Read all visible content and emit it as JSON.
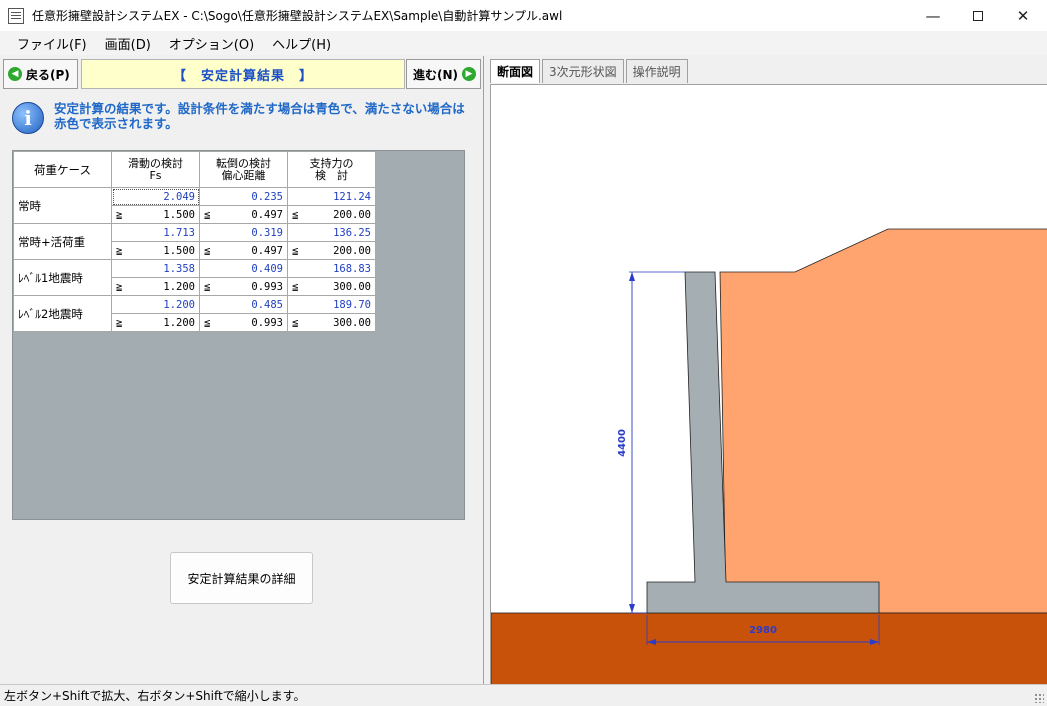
{
  "window": {
    "title": "任意形擁壁設計システムEX - C:\\Sogo\\任意形擁壁設計システムEX\\Sample\\自動計算サンプル.awl",
    "icon": "document-icon"
  },
  "menu": [
    "ファイル(F)",
    "画面(D)",
    "オプション(O)",
    "ヘルプ(H)"
  ],
  "nav": {
    "back_label": "戻る(P)",
    "forward_label": "進む(N)",
    "page_title": "【　安定計算結果　】"
  },
  "info": {
    "text": "安定計算の結果です。設計条件を満たす場合は青色で、満たさない場合は赤色で表示されます。"
  },
  "table": {
    "headers": [
      {
        "line1": "荷重ケース",
        "line2": ""
      },
      {
        "line1": "滑動の検討",
        "line2": "Fs"
      },
      {
        "line1": "転倒の検討",
        "line2": "偏心距離"
      },
      {
        "line1": "支持力の",
        "line2": "検　討"
      }
    ],
    "rows": [
      {
        "case": "常時",
        "values": [
          "2.049",
          "0.235",
          "121.24"
        ],
        "criteria": [
          {
            "sym": "≧",
            "val": "1.500"
          },
          {
            "sym": "≦",
            "val": "0.497"
          },
          {
            "sym": "≦",
            "val": "200.00"
          }
        ]
      },
      {
        "case": "常時+活荷重",
        "values": [
          "1.713",
          "0.319",
          "136.25"
        ],
        "criteria": [
          {
            "sym": "≧",
            "val": "1.500"
          },
          {
            "sym": "≦",
            "val": "0.497"
          },
          {
            "sym": "≦",
            "val": "200.00"
          }
        ]
      },
      {
        "case": "ﾚﾍﾞﾙ1地震時",
        "values": [
          "1.358",
          "0.409",
          "168.83"
        ],
        "criteria": [
          {
            "sym": "≧",
            "val": "1.200"
          },
          {
            "sym": "≦",
            "val": "0.993"
          },
          {
            "sym": "≦",
            "val": "300.00"
          }
        ]
      },
      {
        "case": "ﾚﾍﾞﾙ2地震時",
        "values": [
          "1.200",
          "0.485",
          "189.70"
        ],
        "criteria": [
          {
            "sym": "≧",
            "val": "1.200"
          },
          {
            "sym": "≦",
            "val": "0.993"
          },
          {
            "sym": "≦",
            "val": "300.00"
          }
        ]
      }
    ]
  },
  "detail_button": "安定計算結果の詳細",
  "tabs": [
    "断面図",
    "3次元形状図",
    "操作説明"
  ],
  "drawing": {
    "height_dim": "4400",
    "width_dim": "2980",
    "colors": {
      "backfill": "#ffa36f",
      "ground": "#c8520a",
      "wall": "#a5aeb2",
      "dimension": "#2b3cc8"
    }
  },
  "status": "左ボタン+Shiftで拡大、右ボタン+Shiftで縮小します。"
}
